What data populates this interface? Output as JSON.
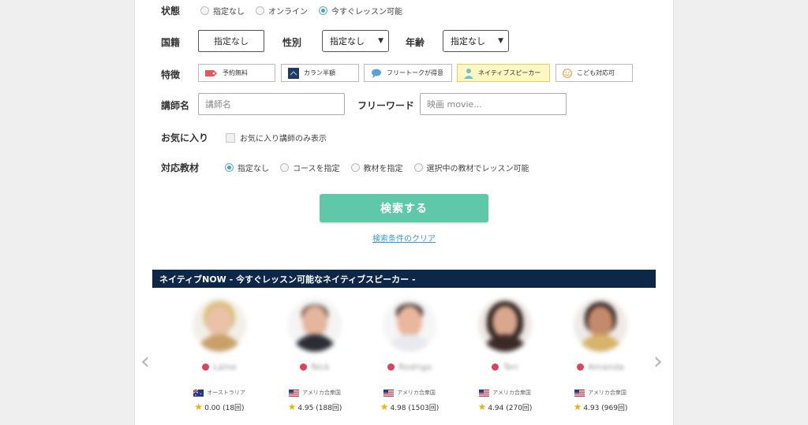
{
  "filters": {
    "status": {
      "label": "状態",
      "options": [
        "指定なし",
        "オンライン",
        "今すぐレッスン可能"
      ],
      "selected_index": 2
    },
    "nationality": {
      "label": "国籍",
      "value": "指定なし"
    },
    "gender": {
      "label": "性別",
      "value": "指定なし"
    },
    "age": {
      "label": "年齢",
      "value": "指定なし"
    },
    "features": {
      "label": "特徴",
      "items": [
        {
          "label": "予約無料",
          "icon": "tag-icon",
          "active": false
        },
        {
          "label": "カラン半額",
          "icon": "callan-book-icon",
          "active": false
        },
        {
          "label": "フリートークが得意",
          "icon": "speech-bubble-icon",
          "active": false
        },
        {
          "label": "ネイティブスピーカー",
          "icon": "person-icon",
          "active": true
        },
        {
          "label": "こども対応可",
          "icon": "smiley-icon",
          "active": false
        }
      ]
    },
    "teacher_name": {
      "label": "講師名",
      "placeholder": "講師名"
    },
    "free_word": {
      "label": "フリーワード",
      "placeholder": "映画 movie..."
    },
    "favorites": {
      "label": "お気に入り",
      "checkbox_label": "お気に入り講師のみ表示",
      "checked": false
    },
    "materials": {
      "label": "対応教材",
      "options": [
        "指定なし",
        "コースを指定",
        "教材を指定",
        "選択中の教材でレッスン可能"
      ],
      "selected_index": 0
    }
  },
  "search_button": "検索する",
  "clear_link": "検索条件のクリア",
  "native_now": {
    "title": "ネイティブNOW - 今すぐレッスン可能なネイティブスピーカー -",
    "prev_arrow": "‹",
    "next_arrow": "›",
    "teachers": [
      {
        "name": "Laine",
        "country": "オーストラリア",
        "rating": "0.00 (18回)",
        "flag": "australia"
      },
      {
        "name": "Nick",
        "country": "アメリカ合衆国",
        "rating": "4.95 (188回)",
        "flag": "usa"
      },
      {
        "name": "Rodrigo",
        "country": "アメリカ合衆国",
        "rating": "4.98 (1503回)",
        "flag": "usa"
      },
      {
        "name": "Teri",
        "country": "アメリカ合衆国",
        "rating": "4.94 (270回)",
        "flag": "usa"
      },
      {
        "name": "Amanda",
        "country": "アメリカ合衆国",
        "rating": "4.93 (969回)",
        "flag": "usa"
      }
    ]
  },
  "colors": {
    "accent_green": "#5ec8a9",
    "banner_navy": "#0d2748",
    "link_blue": "#3a9ad9",
    "status_red": "#e0405a",
    "active_feature_bg": "#fff7c2"
  }
}
